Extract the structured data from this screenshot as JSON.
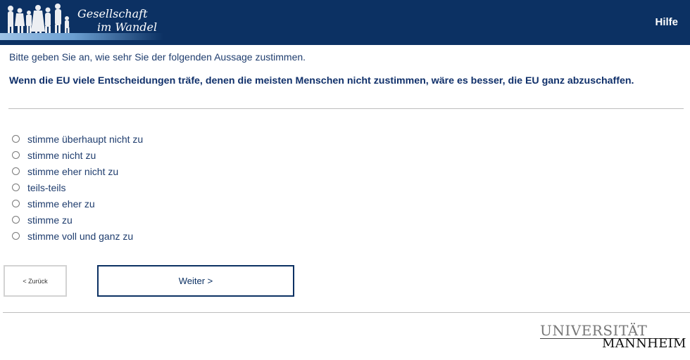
{
  "header": {
    "logo_line1": "Gesellschaft",
    "logo_line2": "im Wandel",
    "help_label": "Hilfe"
  },
  "survey": {
    "intro": "Bitte geben Sie an, wie sehr Sie der folgenden Aussage zustimmen.",
    "question": "Wenn die EU viele Entscheidungen träfe, denen die meisten Menschen nicht zustimmen, wäre es besser, die EU ganz abzuschaffen.",
    "options": [
      {
        "label": "stimme überhaupt nicht zu",
        "selected": false
      },
      {
        "label": "stimme nicht zu",
        "selected": false
      },
      {
        "label": "stimme eher nicht zu",
        "selected": false
      },
      {
        "label": "teils-teils",
        "selected": false
      },
      {
        "label": "stimme eher zu",
        "selected": false
      },
      {
        "label": "stimme zu",
        "selected": false
      },
      {
        "label": "stimme voll und ganz zu",
        "selected": false
      }
    ]
  },
  "nav": {
    "back_label": "< Zurück",
    "next_label": "Weiter >"
  },
  "footer": {
    "uni_line1": "UNIVERSITÄT",
    "uni_line2": "MANNHEIM"
  },
  "colors": {
    "header_bg": "#0c3163",
    "text": "#1f3d6e",
    "divider": "#bdbdbd"
  }
}
